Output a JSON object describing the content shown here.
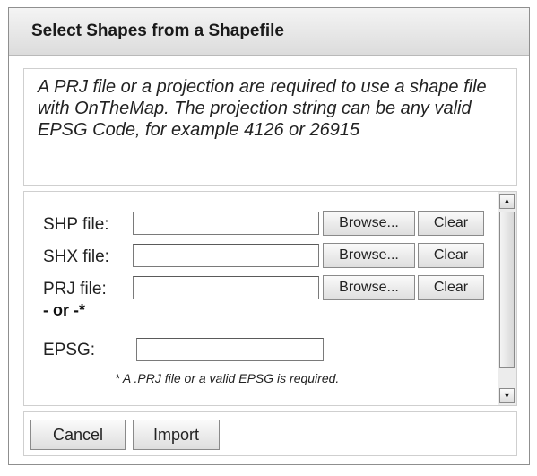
{
  "dialog": {
    "title": "Select Shapes from a Shapefile",
    "info": "A PRJ file or a projection are required to use a shape file with OnTheMap. The projection string can be any valid EPSG Code, for example 4126 or 26915"
  },
  "form": {
    "rows": [
      {
        "label": "SHP file:",
        "value": "",
        "browse_label": "Browse...",
        "clear_label": "Clear"
      },
      {
        "label": "SHX file:",
        "value": "",
        "browse_label": "Browse...",
        "clear_label": "Clear"
      },
      {
        "label": "PRJ file:",
        "value": "",
        "browse_label": "Browse...",
        "clear_label": "Clear"
      }
    ],
    "or_label": "- or -*",
    "epsg_label": "EPSG:",
    "epsg_value": "",
    "note": "* A .PRJ file or a valid EPSG is required."
  },
  "footer": {
    "cancel_label": "Cancel",
    "import_label": "Import"
  }
}
